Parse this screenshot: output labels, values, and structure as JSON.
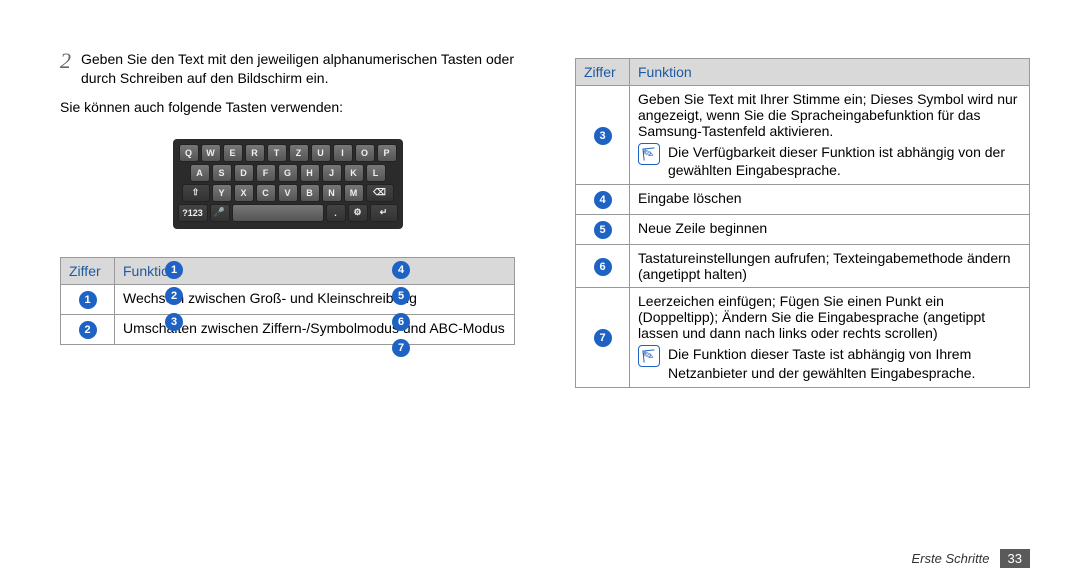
{
  "left": {
    "step_num": "2",
    "step_text": "Geben Sie den Text mit den jeweiligen alphanumerischen Tasten oder durch Schreiben auf den Bildschirm ein.",
    "body": "Sie können auch folgende Tasten verwenden:",
    "keyboard": {
      "row1": [
        "Q",
        "W",
        "E",
        "R",
        "T",
        "Z",
        "U",
        "I",
        "O",
        "P"
      ],
      "row2": [
        "A",
        "S",
        "D",
        "F",
        "G",
        "H",
        "J",
        "K",
        "L"
      ],
      "row3_shift": "⇧",
      "row3": [
        "Y",
        "X",
        "C",
        "V",
        "B",
        "N",
        "M"
      ],
      "row3_del": "⌫",
      "row4_mode": "?123",
      "row4_mic": "🎤",
      "row4_space": "",
      "row4_dot": ".",
      "row4_set": "⚙",
      "row4_enter": "↵"
    },
    "callouts": {
      "c1": "1",
      "c2": "2",
      "c3": "3",
      "c4": "4",
      "c5": "5",
      "c6": "6",
      "c7": "7"
    },
    "table": {
      "head_ziffer": "Ziffer",
      "head_funktion": "Funktion",
      "rows": [
        {
          "n": "1",
          "text": "Wechseln zwischen Groß- und Kleinschreibung"
        },
        {
          "n": "2",
          "text": "Umschalten zwischen Ziffern-/Symbolmodus und ABC-Modus"
        }
      ]
    }
  },
  "right": {
    "table": {
      "head_ziffer": "Ziffer",
      "head_funktion": "Funktion",
      "rows": [
        {
          "n": "3",
          "text": "Geben Sie Text mit Ihrer Stimme ein; Dieses Symbol wird nur angezeigt, wenn Sie die Spracheingabefunktion für das Samsung-Tastenfeld aktivieren.",
          "note": "Die Verfügbarkeit dieser Funktion ist abhängig von der gewählten Eingabesprache."
        },
        {
          "n": "4",
          "text": "Eingabe löschen"
        },
        {
          "n": "5",
          "text": "Neue Zeile beginnen"
        },
        {
          "n": "6",
          "text": "Tastatureinstellungen aufrufen; Texteingabemethode ändern (angetippt halten)"
        },
        {
          "n": "7",
          "text": "Leerzeichen einfügen; Fügen Sie einen Punkt ein (Doppeltipp); Ändern Sie die Eingabesprache (angetippt lassen und dann nach links oder rechts scrollen)",
          "note": "Die Funktion dieser Taste ist abhängig von Ihrem Netzanbieter und der gewählten Eingabesprache."
        }
      ]
    }
  },
  "footer": {
    "section": "Erste Schritte",
    "page": "33"
  }
}
